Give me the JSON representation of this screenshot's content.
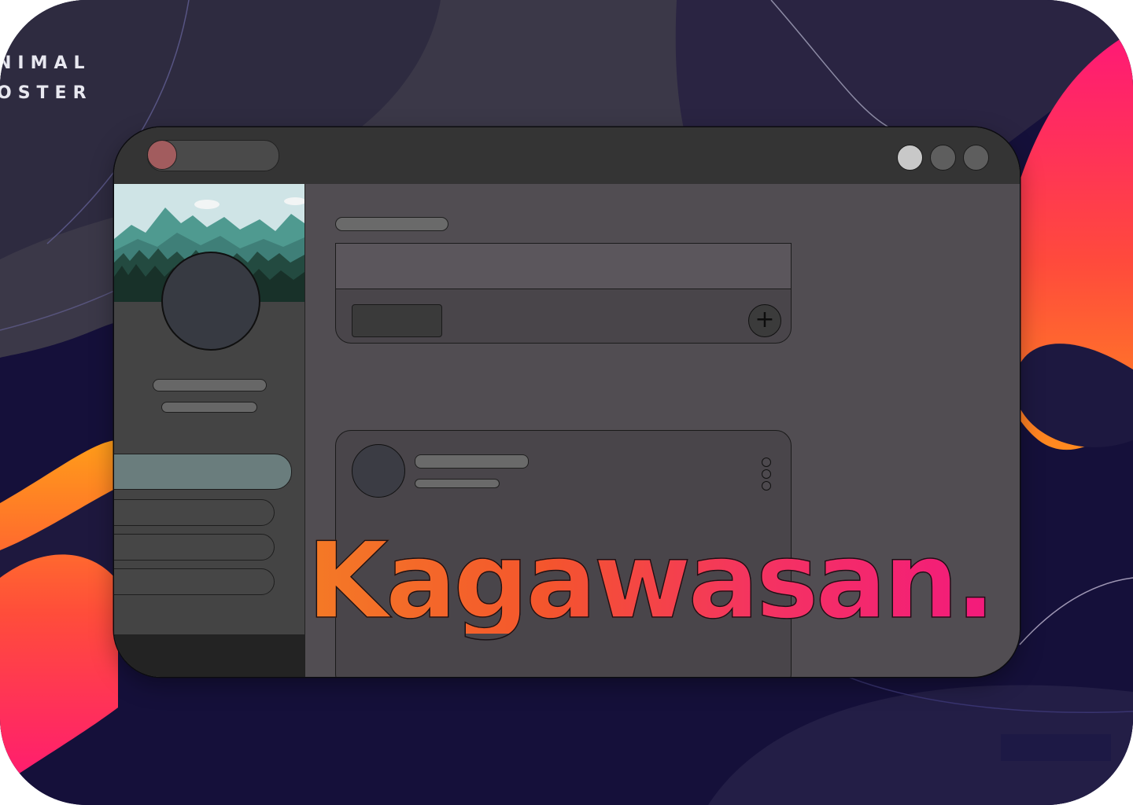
{
  "brand": {
    "line1": "NIMAL",
    "line2": "OSTER"
  },
  "headline": "Kagawasan.",
  "window": {
    "titlebar": {
      "tab_icon": "circle-record-icon",
      "controls": [
        "minimize-circle",
        "maximize-circle",
        "close-circle"
      ]
    },
    "composer": {
      "add_icon": "plus-icon",
      "add_glyph": "+"
    },
    "post": {
      "menu_icon": "vertical-ellipsis-icon"
    }
  },
  "colors": {
    "page_bg": "#17123a",
    "accent_orange": "#f47a26",
    "accent_pink": "#f31a7c",
    "window_bg": "#514d52",
    "titlebar": "#343434",
    "sidebar": "#444444",
    "nav_active": "#6a7d7d",
    "tab_dot": "#a25c5e"
  }
}
